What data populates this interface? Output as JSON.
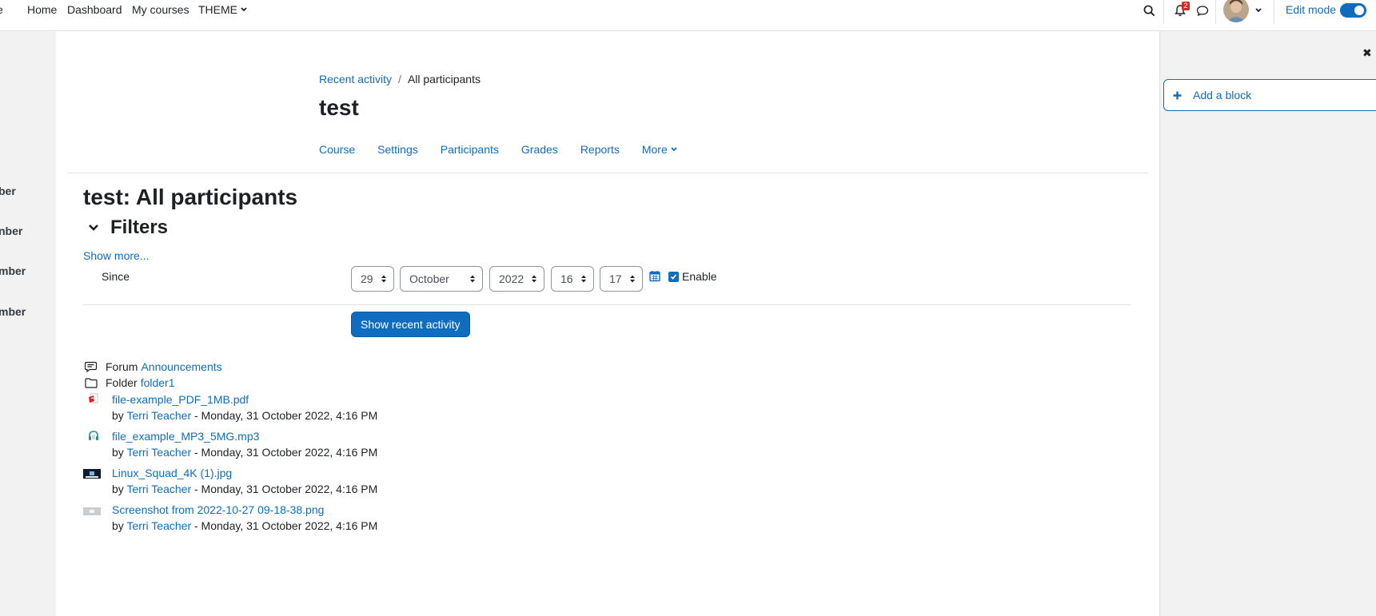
{
  "navbar": {
    "cut_brand": "e",
    "items": [
      "Home",
      "Dashboard",
      "My courses",
      "THEME"
    ],
    "notification_count": "2",
    "edit_mode_label": "Edit mode"
  },
  "left_drawer": {
    "labels": [
      "ber",
      "nber",
      "mber",
      "mber"
    ]
  },
  "breadcrumb": {
    "parent": "Recent activity",
    "separator": "/",
    "current": "All participants"
  },
  "course_title": "test",
  "secondary_nav": [
    "Course",
    "Settings",
    "Participants",
    "Grades",
    "Reports",
    "More"
  ],
  "page_heading": "test: All participants",
  "filters": {
    "heading": "Filters",
    "show_more": "Show more...",
    "since_label": "Since",
    "day": "29",
    "month": "October",
    "year": "2022",
    "hour": "16",
    "minute": "17",
    "enable_label": "Enable",
    "submit_label": "Show recent activity"
  },
  "activities": [
    {
      "type": "Forum",
      "name": "Announcements",
      "icon": "forum-icon"
    },
    {
      "type": "Folder",
      "name": "folder1",
      "icon": "folder-icon"
    }
  ],
  "files": [
    {
      "name": "file-example_PDF_1MB.pdf",
      "by_prefix": "by",
      "author": "Terri Teacher",
      "date": "- Monday, 31 October 2022, 4:16 PM",
      "icon": "pdf-icon"
    },
    {
      "name": "file_example_MP3_5MG.mp3",
      "by_prefix": "by",
      "author": "Terri Teacher",
      "date": "- Monday, 31 October 2022, 4:16 PM",
      "icon": "audio-icon"
    },
    {
      "name": "Linux_Squad_4K (1).jpg",
      "by_prefix": "by",
      "author": "Terri Teacher",
      "date": "- Monday, 31 October 2022, 4:16 PM",
      "icon": "image-icon"
    },
    {
      "name": "Screenshot from 2022-10-27 09-18-38.png",
      "by_prefix": "by",
      "author": "Terri Teacher",
      "date": "- Monday, 31 October 2022, 4:16 PM",
      "icon": "image-icon"
    }
  ],
  "right_drawer": {
    "add_block_label": "Add a block"
  },
  "colors": {
    "accent": "#0f6cbf",
    "badge": "#ca3120"
  }
}
